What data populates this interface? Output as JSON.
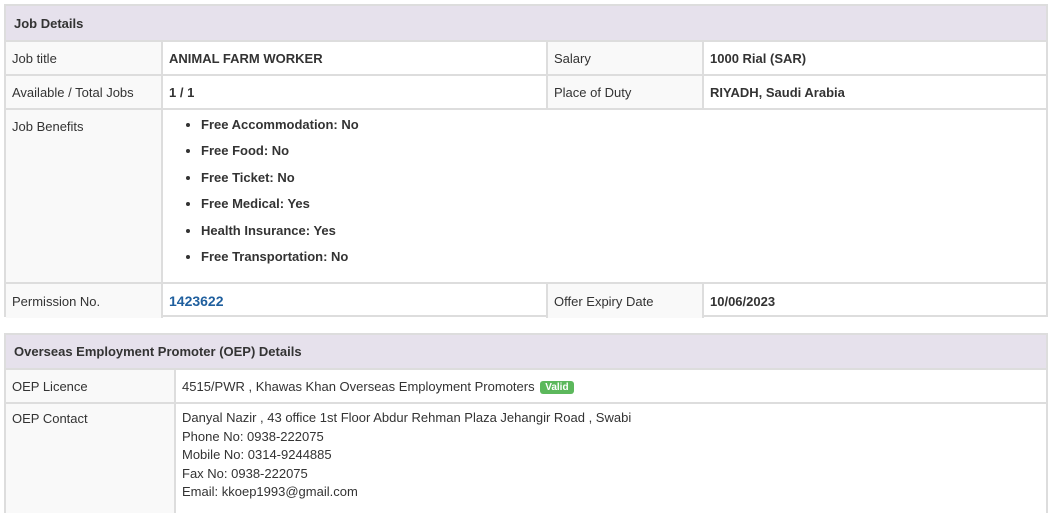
{
  "job_details": {
    "heading": "Job Details",
    "rows": {
      "job_title_label": "Job title",
      "job_title_value": "ANIMAL FARM WORKER",
      "salary_label": "Salary",
      "salary_value": "1000 Rial (SAR)",
      "available_label": "Available / Total Jobs",
      "available_value": "1 / 1",
      "place_label": "Place of Duty",
      "place_value": "RIYADH, Saudi Arabia",
      "benefits_label": "Job Benefits",
      "benefits": [
        "Free Accommodation: No",
        "Free Food: No",
        "Free Ticket: No",
        "Free Medical: Yes",
        "Health Insurance: Yes",
        "Free Transportation: No"
      ],
      "permission_label": "Permission No.",
      "permission_value": "1423622",
      "expiry_label": "Offer Expiry Date",
      "expiry_value": "10/06/2023"
    }
  },
  "oep_details": {
    "heading": "Overseas Employment Promoter (OEP) Details",
    "licence_label": "OEP Licence",
    "licence_value": "4515/PWR , Khawas Khan Overseas Employment Promoters",
    "licence_status": "Valid",
    "contact_label": "OEP Contact",
    "contact_lines": [
      "Danyal Nazir , 43 office 1st Floor Abdur Rehman Plaza Jehangir Road , Swabi",
      "Phone No: 0938-222075",
      "Mobile No: 0314-9244885",
      "Fax No: 0938-222075",
      "Email: kkoep1993@gmail.com"
    ]
  },
  "colors": {
    "heading_bg": "#e6e1ec",
    "border": "#dddddd",
    "link": "#1f5f9e",
    "valid_badge": "#5cb85c"
  }
}
